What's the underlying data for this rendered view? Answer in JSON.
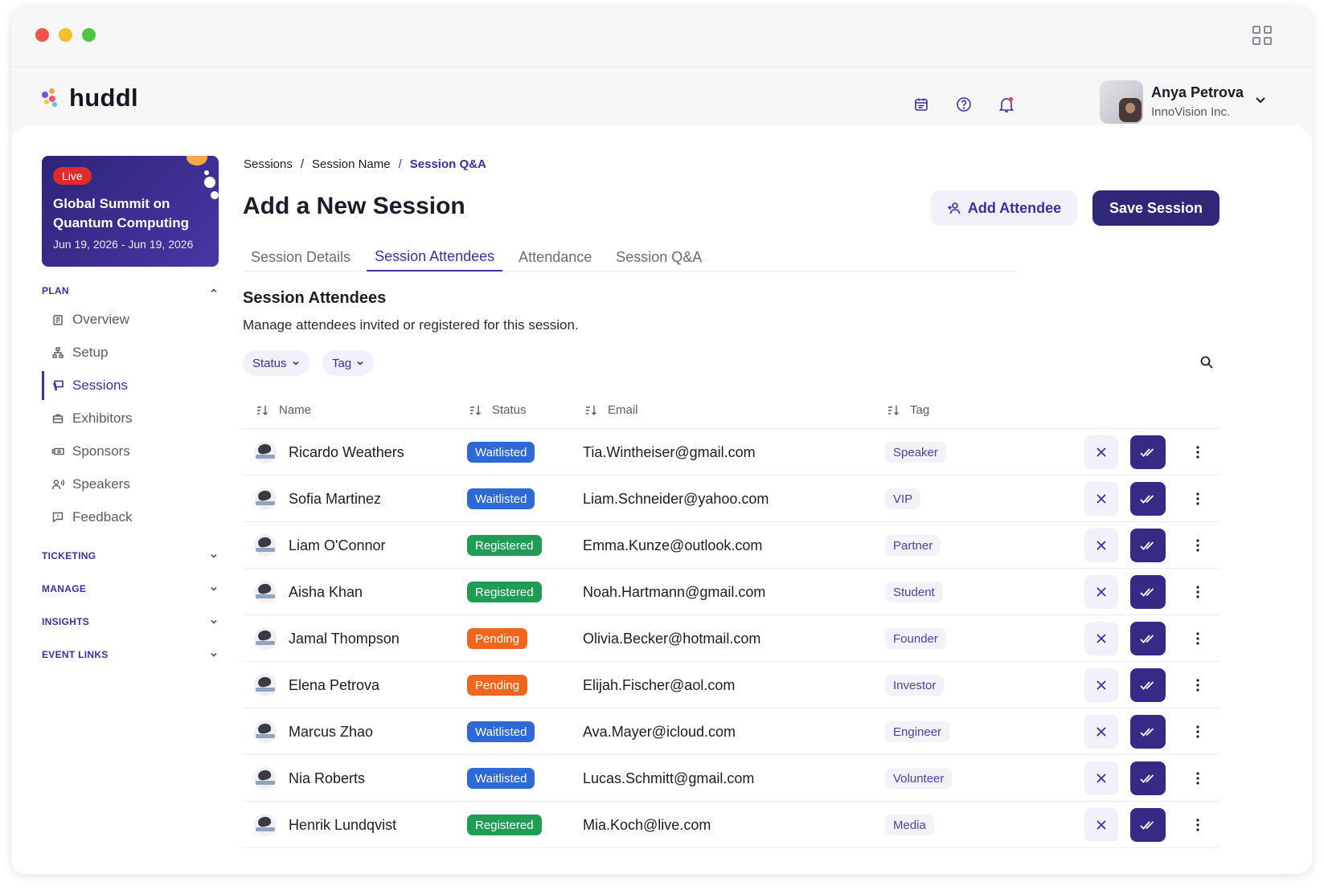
{
  "app": {
    "name": "huddl"
  },
  "user": {
    "name": "Anya Petrova",
    "org": "InnoVision Inc."
  },
  "event": {
    "live_label": "Live",
    "title": "Global Summit on Quantum Computing",
    "dates": "Jun 19, 2026 - Jun 19, 2026"
  },
  "sidebar": {
    "plan_label": "PLAN",
    "plan_items": [
      {
        "label": "Overview",
        "icon": "clipboard-icon"
      },
      {
        "label": "Setup",
        "icon": "sitemap-icon"
      },
      {
        "label": "Sessions",
        "icon": "presentation-icon",
        "active": true
      },
      {
        "label": "Exhibitors",
        "icon": "briefcase-icon"
      },
      {
        "label": "Sponsors",
        "icon": "money-icon"
      },
      {
        "label": "Speakers",
        "icon": "speaker-icon"
      },
      {
        "label": "Feedback",
        "icon": "feedback-icon"
      }
    ],
    "sections": [
      "TICKETING",
      "MANAGE",
      "INSIGHTS",
      "EVENT LINKS"
    ]
  },
  "breadcrumb": [
    "Sessions",
    "Session Name",
    "Session Q&A"
  ],
  "page": {
    "title": "Add a New Session",
    "add_attendee_label": "Add Attendee",
    "save_label": "Save Session"
  },
  "tabs": [
    "Session Details",
    "Session Attendees",
    "Attendance",
    "Session Q&A"
  ],
  "active_tab": "Session Attendees",
  "section": {
    "title": "Session Attendees",
    "description": "Manage attendees invited or registered for this session."
  },
  "filters": [
    "Status",
    "Tag"
  ],
  "table": {
    "headers": [
      "Name",
      "Status",
      "Email",
      "Tag"
    ],
    "rows": [
      {
        "name": "Ricardo Weathers",
        "status": "Waitlisted",
        "email": "Tia.Wintheiser@gmail.com",
        "tag": "Speaker"
      },
      {
        "name": "Sofia Martinez",
        "status": "Waitlisted",
        "email": "Liam.Schneider@yahoo.com",
        "tag": "VIP"
      },
      {
        "name": "Liam O'Connor",
        "status": "Registered",
        "email": "Emma.Kunze@outlook.com",
        "tag": "Partner"
      },
      {
        "name": "Aisha Khan",
        "status": "Registered",
        "email": "Noah.Hartmann@gmail.com",
        "tag": "Student"
      },
      {
        "name": "Jamal Thompson",
        "status": "Pending",
        "email": "Olivia.Becker@hotmail.com",
        "tag": "Founder"
      },
      {
        "name": "Elena Petrova",
        "status": "Pending",
        "email": "Elijah.Fischer@aol.com",
        "tag": "Investor"
      },
      {
        "name": "Marcus Zhao",
        "status": "Waitlisted",
        "email": "Ava.Mayer@icloud.com",
        "tag": "Engineer"
      },
      {
        "name": "Nia Roberts",
        "status": "Waitlisted",
        "email": "Lucas.Schmitt@gmail.com",
        "tag": "Volunteer"
      },
      {
        "name": "Henrik Lundqvist",
        "status": "Registered",
        "email": "Mia.Koch@live.com",
        "tag": "Media"
      }
    ]
  },
  "colors": {
    "primary": "#3c2fa0",
    "primary_dark": "#2f2778",
    "waitlisted": "#2d6ad8",
    "registered": "#1f9d55",
    "pending": "#f0661e",
    "live": "#e12b2b"
  }
}
